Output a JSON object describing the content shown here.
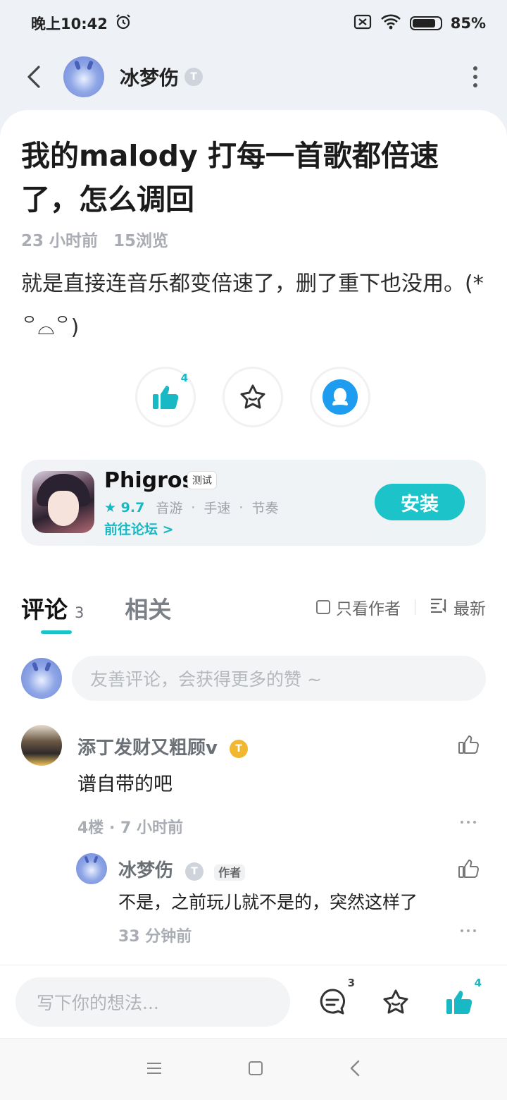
{
  "status_bar": {
    "time": "晚上10:42",
    "battery": "85%"
  },
  "header": {
    "username": "冰梦伤",
    "user_badge": "T"
  },
  "post": {
    "title": "我的malody 打每一首歌都倍速了，怎么调回",
    "time_ago": "23 小时前",
    "views": "15浏览",
    "body": "就是直接连音乐都变倍速了，删了重下也没用。(*꒪⌓꒪)",
    "like_count": "4"
  },
  "app_card": {
    "name": "Phigros",
    "tag": "测试",
    "rating": "9.7",
    "genres": [
      "音游",
      "手速",
      "节奏"
    ],
    "forum_link": "前往论坛 >",
    "install_label": "安装",
    "accent_color": "#1cc3c9"
  },
  "comments_section": {
    "tab_comments": "评论",
    "comment_count": "3",
    "tab_related": "相关",
    "filter_author": "只看作者",
    "filter_sort": "最新",
    "input_placeholder": "友善评论，会获得更多的赞 ~"
  },
  "comment": {
    "author": "添丁发财又粗顾v",
    "badge": "T",
    "text": "谱自带的吧",
    "meta": "4楼 · 7 小时前"
  },
  "reply": {
    "author": "冰梦伤",
    "badge": "T",
    "author_tag": "作者",
    "text": "不是，之前玩儿就不是的，突然这样了",
    "time": "33 分钟前"
  },
  "bottom_bar": {
    "placeholder": "写下你的想法...",
    "comment_count": "3",
    "like_count": "4"
  }
}
